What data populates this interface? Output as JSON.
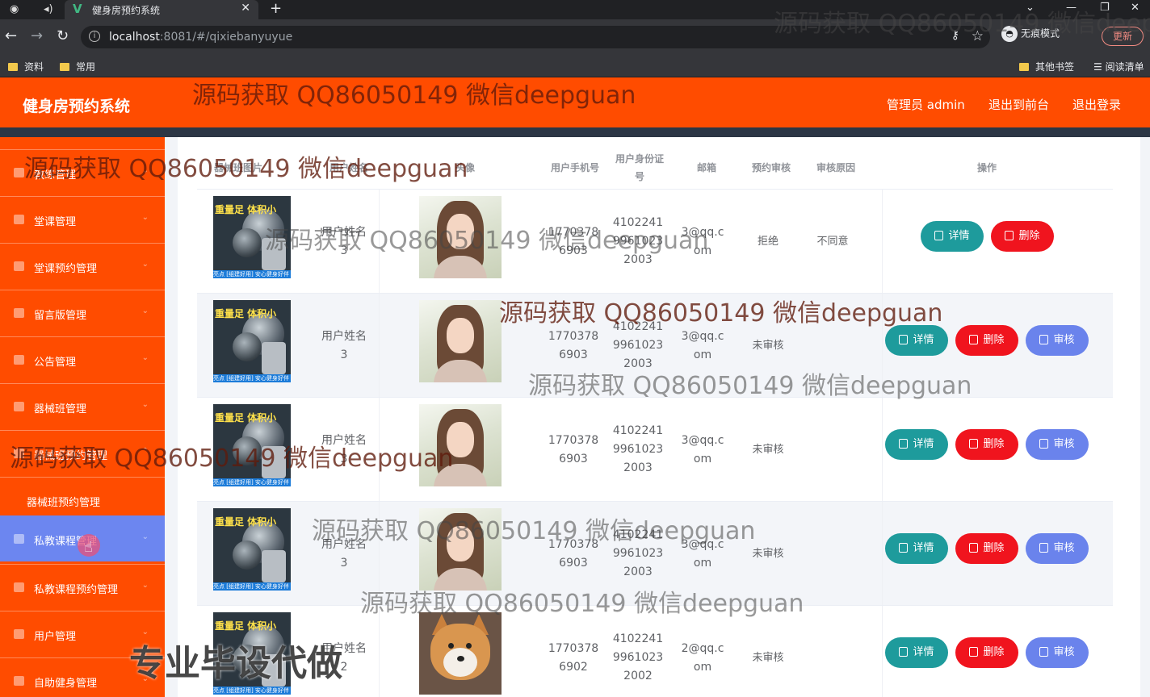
{
  "browser": {
    "tab_title": "健身房预约系统",
    "url_host": "localhost",
    "url_rest": ":8081/#/qixiebanyuyue",
    "incognito_label": "无痕模式",
    "update_label": "更新",
    "bookmarks": [
      "资料",
      "常用"
    ],
    "bookmarks_right": [
      "其他书签",
      "阅读清单"
    ]
  },
  "header": {
    "brand": "健身房预约系统",
    "admin_label": "管理员 admin",
    "to_front_label": "退出到前台",
    "logout_label": "退出登录"
  },
  "sidebar": {
    "items": [
      {
        "label": "教练管理",
        "sub": false,
        "active": false
      },
      {
        "label": "堂课管理",
        "sub": false,
        "active": false
      },
      {
        "label": "堂课预约管理",
        "sub": false,
        "active": false
      },
      {
        "label": "留言版管理",
        "sub": false,
        "active": false
      },
      {
        "label": "公告管理",
        "sub": false,
        "active": false
      },
      {
        "label": "器械班管理",
        "sub": false,
        "active": false
      },
      {
        "label": "器械班预约管理",
        "sub": false,
        "active": false
      },
      {
        "label": "器械班预约管理",
        "sub": true,
        "active": false
      },
      {
        "label": "私教课程管理",
        "sub": false,
        "active": true
      },
      {
        "label": "私教课程预约管理",
        "sub": false,
        "active": false
      },
      {
        "label": "用户管理",
        "sub": false,
        "active": false
      },
      {
        "label": "自助健身管理",
        "sub": false,
        "active": false
      }
    ]
  },
  "table": {
    "headers": [
      "器械班图片",
      "用户姓名",
      "头像",
      "用户手机号",
      "用户身份证号",
      "邮箱",
      "预约审核",
      "审核原因",
      "操作"
    ],
    "rows": [
      {
        "name": "用户姓名 3",
        "avatar": "girl-photo",
        "phone": "1770378 6903",
        "idcard": "4102241 9961023 2003",
        "email": "3@qq.c om",
        "status": "拒绝",
        "reason": "不同意",
        "actions": [
          "详情",
          "删除"
        ]
      },
      {
        "name": "用户姓名 3",
        "avatar": "girl-photo",
        "phone": "1770378 6903",
        "idcard": "4102241 9961023 2003",
        "email": "3@qq.c om",
        "status": "未审核",
        "reason": "",
        "actions": [
          "详情",
          "删除",
          "审核"
        ]
      },
      {
        "name": "用户姓名 3",
        "avatar": "girl-photo",
        "phone": "1770378 6903",
        "idcard": "4102241 9961023 2003",
        "email": "3@qq.c om",
        "status": "未审核",
        "reason": "",
        "actions": [
          "详情",
          "删除",
          "审核"
        ]
      },
      {
        "name": "用户姓名 3",
        "avatar": "girl-photo",
        "phone": "1770378 6903",
        "idcard": "4102241 9961023 2003",
        "email": "3@qq.c om",
        "status": "未审核",
        "reason": "",
        "actions": [
          "详情",
          "删除",
          "审核"
        ]
      },
      {
        "name": "用户姓名 2",
        "avatar": "dog-photo",
        "phone": "1770378 6902",
        "idcard": "4102241 9961023 2002",
        "email": "2@qq.c om",
        "status": "未审核",
        "reason": "",
        "actions": [
          "详情",
          "删除",
          "审核"
        ]
      }
    ]
  },
  "gym_image_text": {
    "tag": "重量足 体积小",
    "bar": "亮点 [组建好用] 安心健身好伴侣"
  },
  "watermarks": {
    "text": "源码获取 QQ86050149 微信deepguan",
    "big": "专业毕设代做"
  },
  "colors": {
    "header": "#ff4c00",
    "sidebar": "#ff4c00",
    "active_menu": "#6c86f0",
    "detail_button": "#1e9b9c",
    "delete_button": "#f0141e",
    "audit_button": "#6a83ec"
  }
}
